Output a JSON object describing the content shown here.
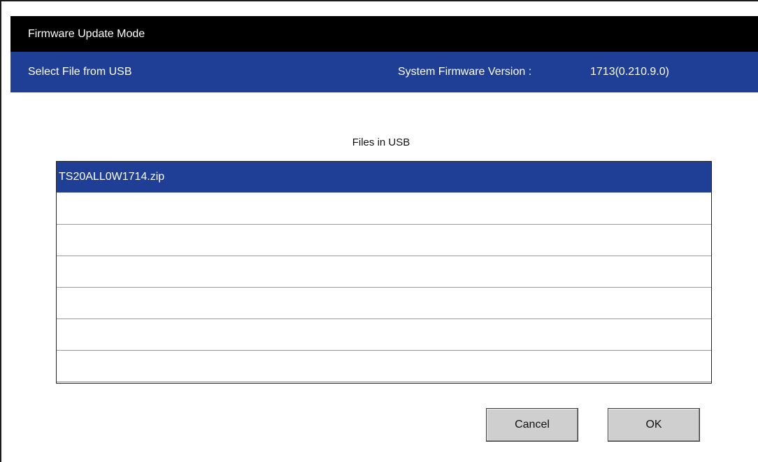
{
  "window": {
    "title": "Firmware Update Mode"
  },
  "subheader": {
    "left_label": "Select File from USB",
    "version_label": "System Firmware Version :",
    "version_value": "1713(0.210.9.0)"
  },
  "file_list": {
    "heading": "Files in USB",
    "selected_index": 0,
    "rows": [
      {
        "name": "TS20ALL0W1714.zip"
      },
      {
        "name": ""
      },
      {
        "name": ""
      },
      {
        "name": ""
      },
      {
        "name": ""
      },
      {
        "name": ""
      },
      {
        "name": ""
      }
    ]
  },
  "buttons": {
    "cancel_label": "Cancel",
    "ok_label": "OK"
  },
  "colors": {
    "title_bar": "#000000",
    "accent_blue": "#1f3f97",
    "button_face": "#cfcfcf"
  }
}
